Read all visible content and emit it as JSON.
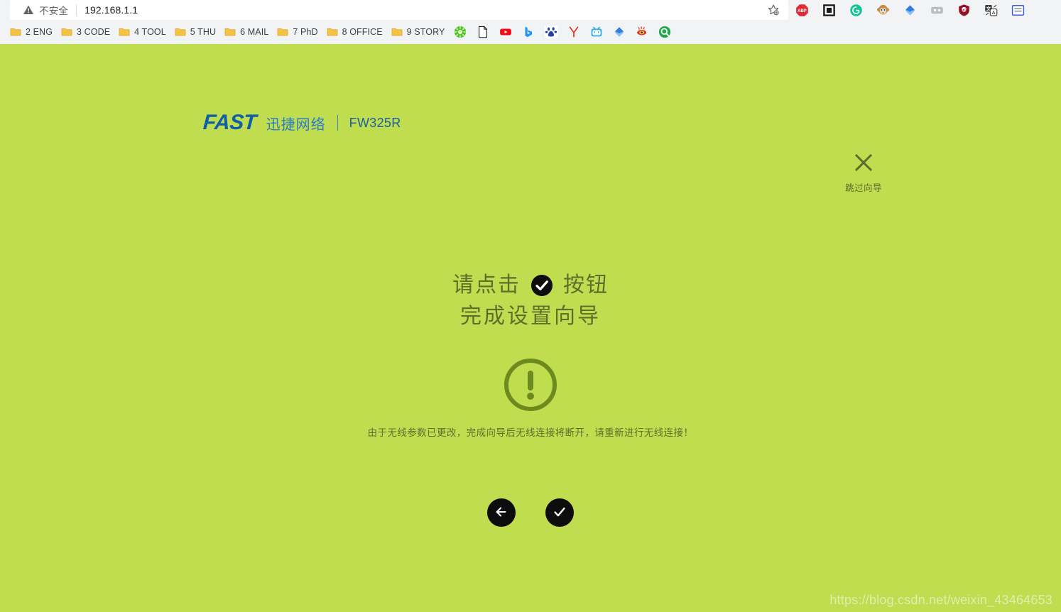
{
  "browser": {
    "omnibox": {
      "security_icon": "warning-triangle-icon",
      "security_label": "不安全",
      "url": "192.168.1.1",
      "bookmark_icon": "star-plus-icon"
    },
    "extensions": [
      {
        "name": "adblock-plus-icon",
        "label": "ABP"
      },
      {
        "name": "square-frame-extension-icon",
        "label": ""
      },
      {
        "name": "grammarly-icon",
        "label": "G"
      },
      {
        "name": "monkey-avatar-extension-icon",
        "label": ""
      },
      {
        "name": "blue-diamond-extension-icon",
        "label": ""
      },
      {
        "name": "gray-pill-extension-icon",
        "label": ""
      },
      {
        "name": "ublock-origin-icon",
        "label": "uO"
      },
      {
        "name": "translate-extension-icon",
        "label": ""
      },
      {
        "name": "reader-list-extension-icon",
        "label": ""
      }
    ],
    "bookmarks": [
      {
        "name": "bookmark-folder-2-eng",
        "label": "2 ENG",
        "type": "folder"
      },
      {
        "name": "bookmark-folder-3-code",
        "label": "3 CODE",
        "type": "folder"
      },
      {
        "name": "bookmark-folder-4-tool",
        "label": "4 TOOL",
        "type": "folder"
      },
      {
        "name": "bookmark-folder-5-thu",
        "label": "5 THU",
        "type": "folder"
      },
      {
        "name": "bookmark-folder-6-mail",
        "label": "6 MAIL",
        "type": "folder"
      },
      {
        "name": "bookmark-folder-7-phd",
        "label": "7 PhD",
        "type": "folder"
      },
      {
        "name": "bookmark-folder-8-office",
        "label": "8 OFFICE",
        "type": "folder"
      },
      {
        "name": "bookmark-folder-9-story",
        "label": "9 STORY",
        "type": "folder"
      }
    ],
    "bookmark_sites": [
      {
        "name": "green-wheel-site-icon"
      },
      {
        "name": "document-page-site-icon"
      },
      {
        "name": "youtube-site-icon"
      },
      {
        "name": "bing-site-icon"
      },
      {
        "name": "baidu-site-icon"
      },
      {
        "name": "yandex-site-icon"
      },
      {
        "name": "bilibili-site-icon"
      },
      {
        "name": "blue-diamond-site-icon"
      },
      {
        "name": "eye-site-icon"
      },
      {
        "name": "green-search-site-icon"
      }
    ]
  },
  "page": {
    "brand": {
      "logo_text": "FAST",
      "company_cn": "迅捷网络",
      "model": "FW325R"
    },
    "skip": {
      "icon": "close-x-icon",
      "label": "跳过向导"
    },
    "headline": {
      "line1_before": "请点击",
      "line1_icon": "check-circle-icon",
      "line1_after": "按钮",
      "line2": "完成设置向导"
    },
    "warning": {
      "icon": "exclamation-circle-icon",
      "message": "由于无线参数已更改，完成向导后无线连接将断开，请重新进行无线连接！"
    },
    "nav_buttons": [
      {
        "name": "back-button",
        "icon": "arrow-left-icon"
      },
      {
        "name": "finish-button",
        "icon": "check-icon"
      }
    ],
    "watermark": "https://blog.csdn.net/weixin_43464653",
    "colors": {
      "background": "#c0dc4f",
      "text_olive": "#5e6e2c",
      "brand_blue": "#0f5fa8",
      "brand_blue_light": "#2a7cc7",
      "button_black": "#0d0d0d",
      "watermark": "#e3eeb4"
    }
  }
}
